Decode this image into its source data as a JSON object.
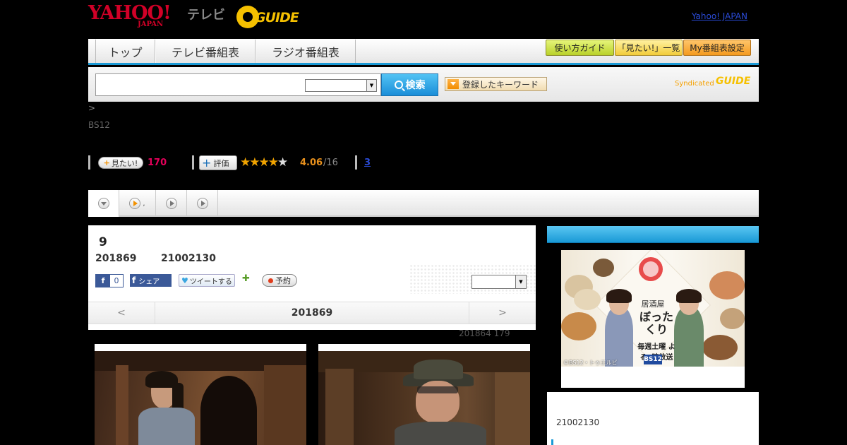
{
  "header": {
    "logo_yahoo": "YAHOO!",
    "logo_japan": "JAPAN",
    "logo_tv": "テレビ",
    "logo_g": "GUIDE",
    "link": "Yahoo! JAPAN"
  },
  "nav": {
    "tabs": [
      {
        "label": "トップ"
      },
      {
        "label": "テレビ番組表"
      },
      {
        "label": "ラジオ番組表"
      }
    ],
    "sub_buttons": [
      {
        "label": "使い方ガイド"
      },
      {
        "label": "「見たい!」一覧"
      },
      {
        "label": "My番組表設定"
      }
    ]
  },
  "search": {
    "input_value": "",
    "select_value": "",
    "button_label": "検索",
    "keyword_button": "登録したキーワード",
    "syndicated_text": "Syndicated",
    "syndicated_g": "GUIDE"
  },
  "breadcrumb": ">",
  "channel": "BS12",
  "stats": {
    "mitai_label": "見たい!",
    "mitai_count": "170",
    "hyoka_label": "評価",
    "rating": 4.06,
    "score": "4.06",
    "score_count": "/16",
    "link_num": "3"
  },
  "subtabs": [
    {
      "label": ""
    },
    {
      "label": ","
    },
    {
      "label": ""
    },
    {
      "label": ""
    }
  ],
  "program": {
    "title": "9",
    "date": "201869",
    "time": "21002130",
    "fb_like_count": "0",
    "fb_share": "シェア",
    "tweet": "ツイートする",
    "reserve": "予約",
    "select_value": ""
  },
  "pager": {
    "prev": "<",
    "current": "201869",
    "next": ">"
  },
  "update_note": "201864  179",
  "sidebar": {
    "ad": {
      "name": "居酒屋",
      "title": "ぼったくり",
      "schedule": "毎週土曜 よる9時放送",
      "logo": "BS12",
      "copyright": "©BS12・トゥエルビ"
    },
    "time": "21002130"
  },
  "colors": {
    "accent_blue": "#1a9ad6",
    "yahoo_red": "#d10027",
    "guide_yellow": "#f5c000",
    "mitai_pink": "#e5005a",
    "star_orange": "#f0a300"
  }
}
